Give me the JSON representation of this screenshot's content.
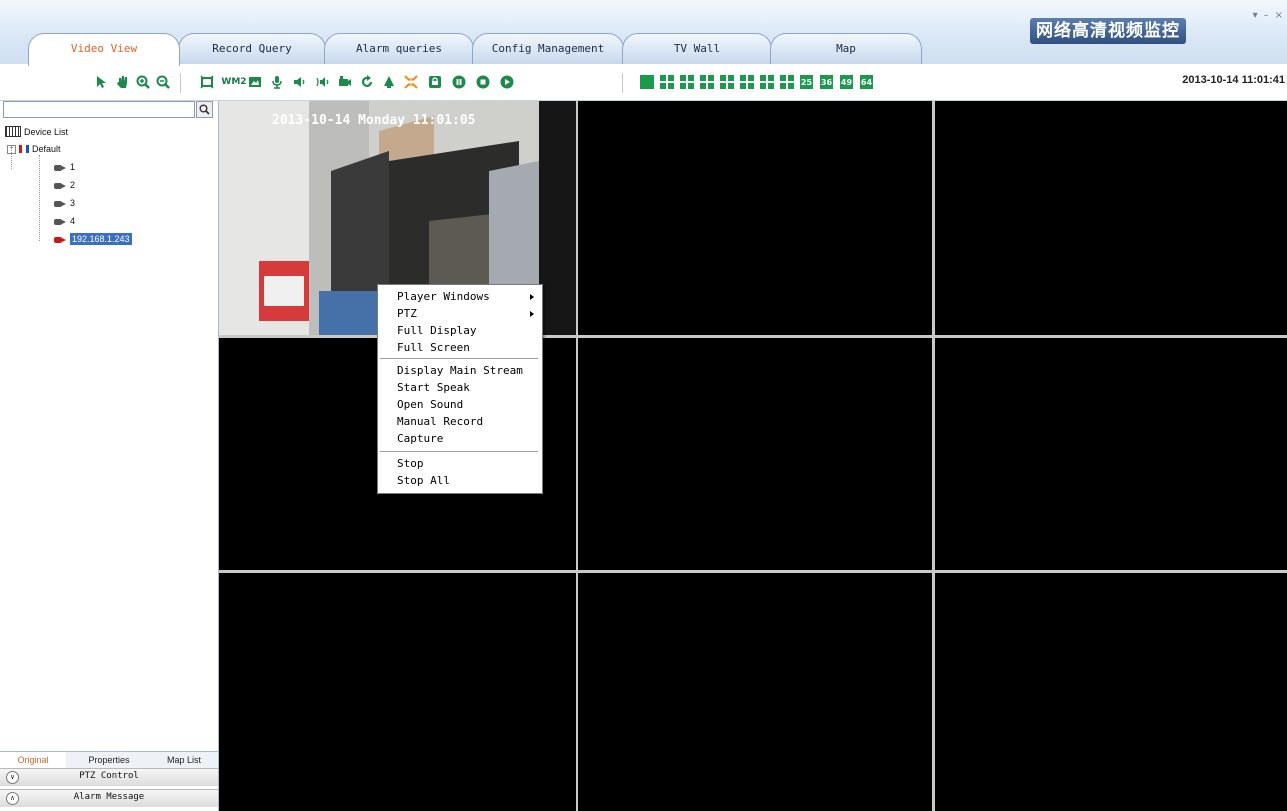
{
  "tabs": [
    "Video View",
    "Record Query",
    "Alarm queries",
    "Config Management",
    "TV Wall",
    "Map"
  ],
  "brand_title": "网络高清视频监控",
  "window_controls": [
    "▾",
    "–",
    "×"
  ],
  "toolbar": {
    "datetime": "2013-10-14 11:01:41",
    "icons": [
      "pointer-icon",
      "hand-pan-icon",
      "zoom-in-icon",
      "zoom-out-icon",
      "fullscreen-icon",
      "wm2-icon",
      "snapshot-icon",
      "microphone-icon",
      "volume-icon",
      "talk-icon",
      "record-icon",
      "refresh-icon",
      "alarm-bell-icon",
      "shrink-icon",
      "lock-icon",
      "pause-icon",
      "stop-icon",
      "play-icon"
    ],
    "wm2_label": "WM2",
    "layout_numbers": [
      "25",
      "36",
      "49",
      "64"
    ]
  },
  "search": {
    "placeholder": "",
    "value": ""
  },
  "device_tree": {
    "root": "Device List",
    "group": "Default",
    "items": [
      "1",
      "2",
      "3",
      "4"
    ],
    "selected_item": "192.168.1.243"
  },
  "bottom_tabs": [
    "Original",
    "Properties",
    "Map List"
  ],
  "accordions": [
    "PTZ Control",
    "Alarm Message"
  ],
  "video": {
    "osd": "2013-10-14 Monday 11:01:05"
  },
  "context_menu": {
    "items": [
      "Player Windows",
      "PTZ",
      "Full Display",
      "Full Screen",
      "Display Main Stream",
      "Start Speak",
      "Open Sound",
      "Manual Record",
      "Capture",
      "Stop",
      "Stop All"
    ]
  },
  "colors": {
    "accent": "#e0642a",
    "toolbar_green": "#1b9a4e",
    "selection_border": "#e02020",
    "tree_selected": "#3a6fc4"
  }
}
